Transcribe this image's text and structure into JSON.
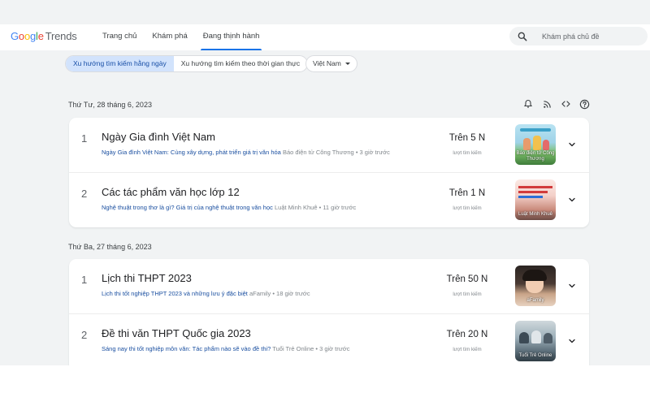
{
  "header": {
    "logo_google": "Google",
    "logo_trends": "Trends",
    "nav": [
      {
        "label": "Trang chủ"
      },
      {
        "label": "Khám phá"
      },
      {
        "label": "Đang thịnh hành"
      }
    ],
    "search_placeholder": "Khám phá chủ đề"
  },
  "filters": {
    "daily": "Xu hướng tìm kiếm hằng ngày",
    "realtime": "Xu hướng tìm kiếm theo thời gian thực",
    "geo": "Việt Nam"
  },
  "days": [
    {
      "date": "Thứ Tư, 28 tháng 6, 2023",
      "items": [
        {
          "rank": "1",
          "title": "Ngày Gia đình Việt Nam",
          "article": "Ngày Gia đình Việt Nam: Cùng xây dựng, phát triển giá trị văn hóa",
          "meta": "Báo điện tử Công Thương • 3 giờ trước",
          "count": "Trên 5 N",
          "count_label": "lượt tìm kiếm",
          "thumb_caption": "Báo điện tử Công Thương"
        },
        {
          "rank": "2",
          "title": "Các tác phẩm văn học lớp 12",
          "article": "Nghệ thuật trong thơ là gì? Giá trị của nghệ thuật trong văn học",
          "meta": "Luật Minh Khuê • 11 giờ trước",
          "count": "Trên 1 N",
          "count_label": "lượt tìm kiếm",
          "thumb_caption": "Luật Minh Khuê"
        }
      ]
    },
    {
      "date": "Thứ Ba, 27 tháng 6, 2023",
      "items": [
        {
          "rank": "1",
          "title": "Lịch thi THPT 2023",
          "article": "Lịch thi tốt nghiệp THPT 2023 và những lưu ý đặc biệt",
          "meta": "aFamily • 18 giờ trước",
          "count": "Trên 50 N",
          "count_label": "lượt tìm kiếm",
          "thumb_caption": "aFamily"
        },
        {
          "rank": "2",
          "title": "Đề thi văn THPT Quốc gia 2023",
          "article": "Sáng nay thi tốt nghiệp môn văn: Tác phẩm nào sẽ vào đề thi?",
          "meta": "Tuổi Trẻ Online • 3 giờ trước",
          "count": "Trên 20 N",
          "count_label": "lượt tìm kiếm",
          "thumb_caption": "Tuổi Trẻ Online"
        }
      ]
    }
  ],
  "icons": [
    "search-icon",
    "notification-bell-icon",
    "rss-icon",
    "embed-code-icon",
    "help-icon",
    "chevron-down-icon",
    "dropdown-caret-icon"
  ],
  "colors": {
    "accent": "#1a73e8",
    "link": "#1a4fa0",
    "active_chip": "#d2e3fc",
    "background": "#f1f3f4"
  }
}
